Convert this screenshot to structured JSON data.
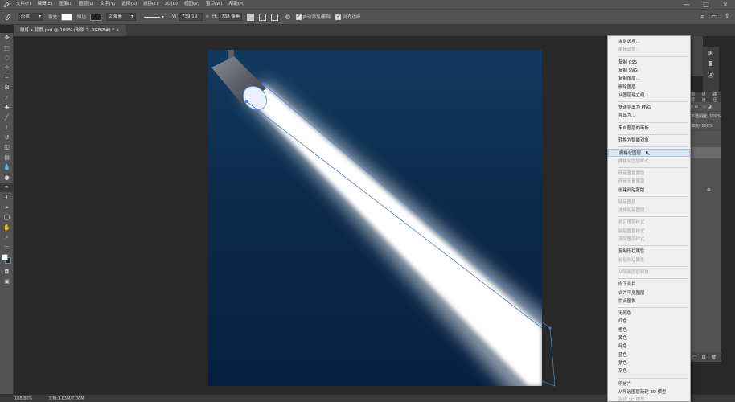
{
  "menubar": {
    "items": [
      "文件(F)",
      "编辑(E)",
      "图像(I)",
      "图层(L)",
      "文字(Y)",
      "选择(S)",
      "滤镜(T)",
      "3D(D)",
      "视图(V)",
      "窗口(W)",
      "帮助(H)"
    ],
    "window_controls": [
      "—",
      "□",
      "×"
    ]
  },
  "options": {
    "tool_mode": "形状",
    "fill_label": "填充:",
    "stroke_label": "描边:",
    "stroke_width": "2 像素",
    "w_label": "W:",
    "w_value": "739.19 l",
    "h_label": "H:",
    "h_value": "738 像素",
    "auto_add_label": "自动添加/删除",
    "align_edges_label": "对齐边缘"
  },
  "document": {
    "tab_label": "射灯 • 背景.psd @ 109% (形状 2, RGB/8#) *"
  },
  "status": {
    "zoom": "108.86%",
    "doc_info": "文档:1.83M/7.06M"
  },
  "layers_panel": {
    "tab1": "图层",
    "tab2": "通道",
    "tab3": "路径",
    "opacity_label": "不透明度:",
    "opacity_value": "100%",
    "fill_label": "填充:",
    "fill_value": "100%"
  },
  "context_menu": {
    "items": [
      {
        "label": "混合选项...",
        "enabled": true
      },
      {
        "label": "编辑调整...",
        "enabled": false
      },
      {
        "sep": true
      },
      {
        "label": "复制 CSS",
        "enabled": true
      },
      {
        "label": "复制 SVG",
        "enabled": true
      },
      {
        "label": "复制图层...",
        "enabled": true
      },
      {
        "label": "删除图层",
        "enabled": true
      },
      {
        "label": "从图层建立组...",
        "enabled": true
      },
      {
        "sep": true
      },
      {
        "label": "快速导出为 PNG",
        "enabled": true
      },
      {
        "label": "导出为...",
        "enabled": true
      },
      {
        "sep": true
      },
      {
        "label": "来自图层的画板...",
        "enabled": true
      },
      {
        "sep": true
      },
      {
        "label": "转换为智能对象",
        "enabled": true
      },
      {
        "sep": true
      },
      {
        "label": "栅格化图层",
        "enabled": true,
        "highlighted": true
      },
      {
        "label": "栅格化图层样式",
        "enabled": false
      },
      {
        "sep": true
      },
      {
        "label": "停用图层蒙版",
        "enabled": false
      },
      {
        "label": "停用矢量蒙版",
        "enabled": false
      },
      {
        "label": "创建剪贴蒙版",
        "enabled": true
      },
      {
        "sep": true
      },
      {
        "label": "链接图层",
        "enabled": false
      },
      {
        "label": "选择链接图层",
        "enabled": false
      },
      {
        "sep": true
      },
      {
        "label": "拷贝图层样式",
        "enabled": false
      },
      {
        "label": "粘贴图层样式",
        "enabled": false
      },
      {
        "label": "清除图层样式",
        "enabled": false
      },
      {
        "sep": true
      },
      {
        "label": "复制形状属性",
        "enabled": true
      },
      {
        "label": "粘贴形状属性",
        "enabled": false
      },
      {
        "sep": true
      },
      {
        "label": "从隔离图层释放",
        "enabled": false
      },
      {
        "sep": true
      },
      {
        "label": "向下合并",
        "enabled": true
      },
      {
        "label": "合并可见图层",
        "enabled": true
      },
      {
        "label": "拼合图像",
        "enabled": true
      },
      {
        "sep": true
      },
      {
        "label": "无颜色",
        "enabled": true
      },
      {
        "label": "红色",
        "enabled": true
      },
      {
        "label": "橙色",
        "enabled": true
      },
      {
        "label": "黄色",
        "enabled": true
      },
      {
        "label": "绿色",
        "enabled": true
      },
      {
        "label": "蓝色",
        "enabled": true
      },
      {
        "label": "紫色",
        "enabled": true
      },
      {
        "label": "灰色",
        "enabled": true
      },
      {
        "sep": true
      },
      {
        "label": "明信片",
        "enabled": true
      },
      {
        "label": "从所选图层新建 3D 模型",
        "enabled": true
      },
      {
        "label": "新建 3D 模型",
        "enabled": false
      }
    ]
  },
  "colors": {
    "foreground": "#ffffff",
    "background": "#0a2a4a",
    "menu_highlight": "#d8e6f5"
  }
}
